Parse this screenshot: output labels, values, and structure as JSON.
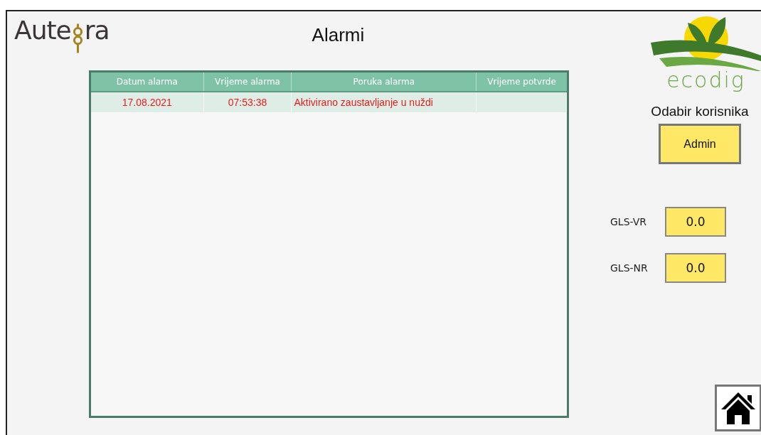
{
  "logo": {
    "left": "Aute",
    "right": "ra"
  },
  "title": "Alarmi",
  "table": {
    "columns": [
      "Datum alarma",
      "Vrijeme alarma",
      "Poruka alarma",
      "Vrijeme potvrde"
    ],
    "rows": [
      {
        "cells": [
          "17.08.2021",
          "07:53:38",
          "Aktivirano zaustavljanje u nuždi",
          ""
        ]
      }
    ]
  },
  "brand": {
    "name": "ecodig"
  },
  "user_select": {
    "label": "Odabir korisnika",
    "button": "Admin"
  },
  "readings": [
    {
      "label": "GLS-VR",
      "value": "0.0"
    },
    {
      "label": "GLS-NR",
      "value": "0.0"
    }
  ]
}
